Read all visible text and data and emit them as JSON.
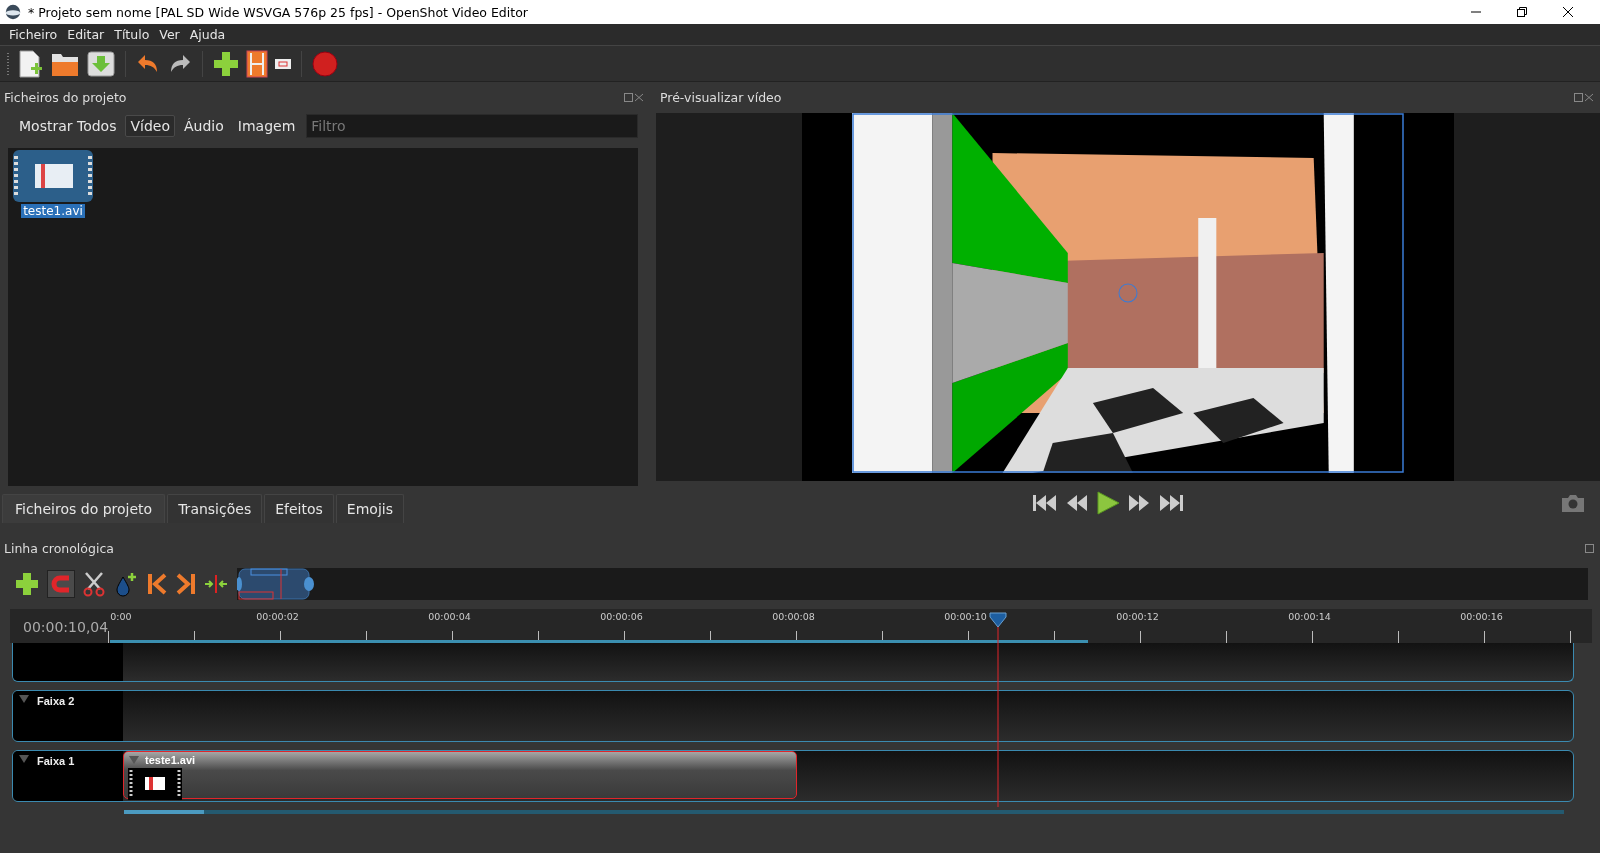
{
  "window": {
    "title": "* Projeto sem nome [PAL SD Wide WSVGA 576p 25 fps] - OpenShot Video Editor"
  },
  "menu": [
    {
      "label": "Ficheiro"
    },
    {
      "label": "Editar"
    },
    {
      "label": "Título"
    },
    {
      "label": "Ver"
    },
    {
      "label": "Ajuda"
    }
  ],
  "project_panel": {
    "title": "Ficheiros do projeto",
    "filters": [
      {
        "label": "Mostrar Todos",
        "selected": false
      },
      {
        "label": "Vídeo",
        "selected": true
      },
      {
        "label": "Áudio",
        "selected": false
      },
      {
        "label": "Imagem",
        "selected": false
      }
    ],
    "filter_field": {
      "placeholder": "Filtro"
    },
    "files": [
      {
        "name": "teste1.avi",
        "selected": true
      }
    ]
  },
  "bottom_tabs": [
    {
      "label": "Ficheiros do projeto",
      "selected": true
    },
    {
      "label": "Transições",
      "selected": false
    },
    {
      "label": "Efeitos",
      "selected": false
    },
    {
      "label": "Emojis",
      "selected": false
    }
  ],
  "preview_panel": {
    "title": "Pré-visualizar vídeo"
  },
  "timeline": {
    "title": "Linha cronológica",
    "current_time": "00:00:10,04",
    "ruler_labels": [
      "0:00",
      "00:00:02",
      "00:00:04",
      "00:00:06",
      "00:00:08",
      "00:00:10",
      "00:00:12",
      "00:00:14",
      "00:00:16"
    ],
    "tracks": [
      {
        "kind": "partial"
      },
      {
        "kind": "track",
        "name": "Faixa 2"
      },
      {
        "kind": "track",
        "name": "Faixa 1",
        "clips": [
          {
            "name": "teste1.avi",
            "selected": true
          }
        ]
      }
    ]
  }
}
